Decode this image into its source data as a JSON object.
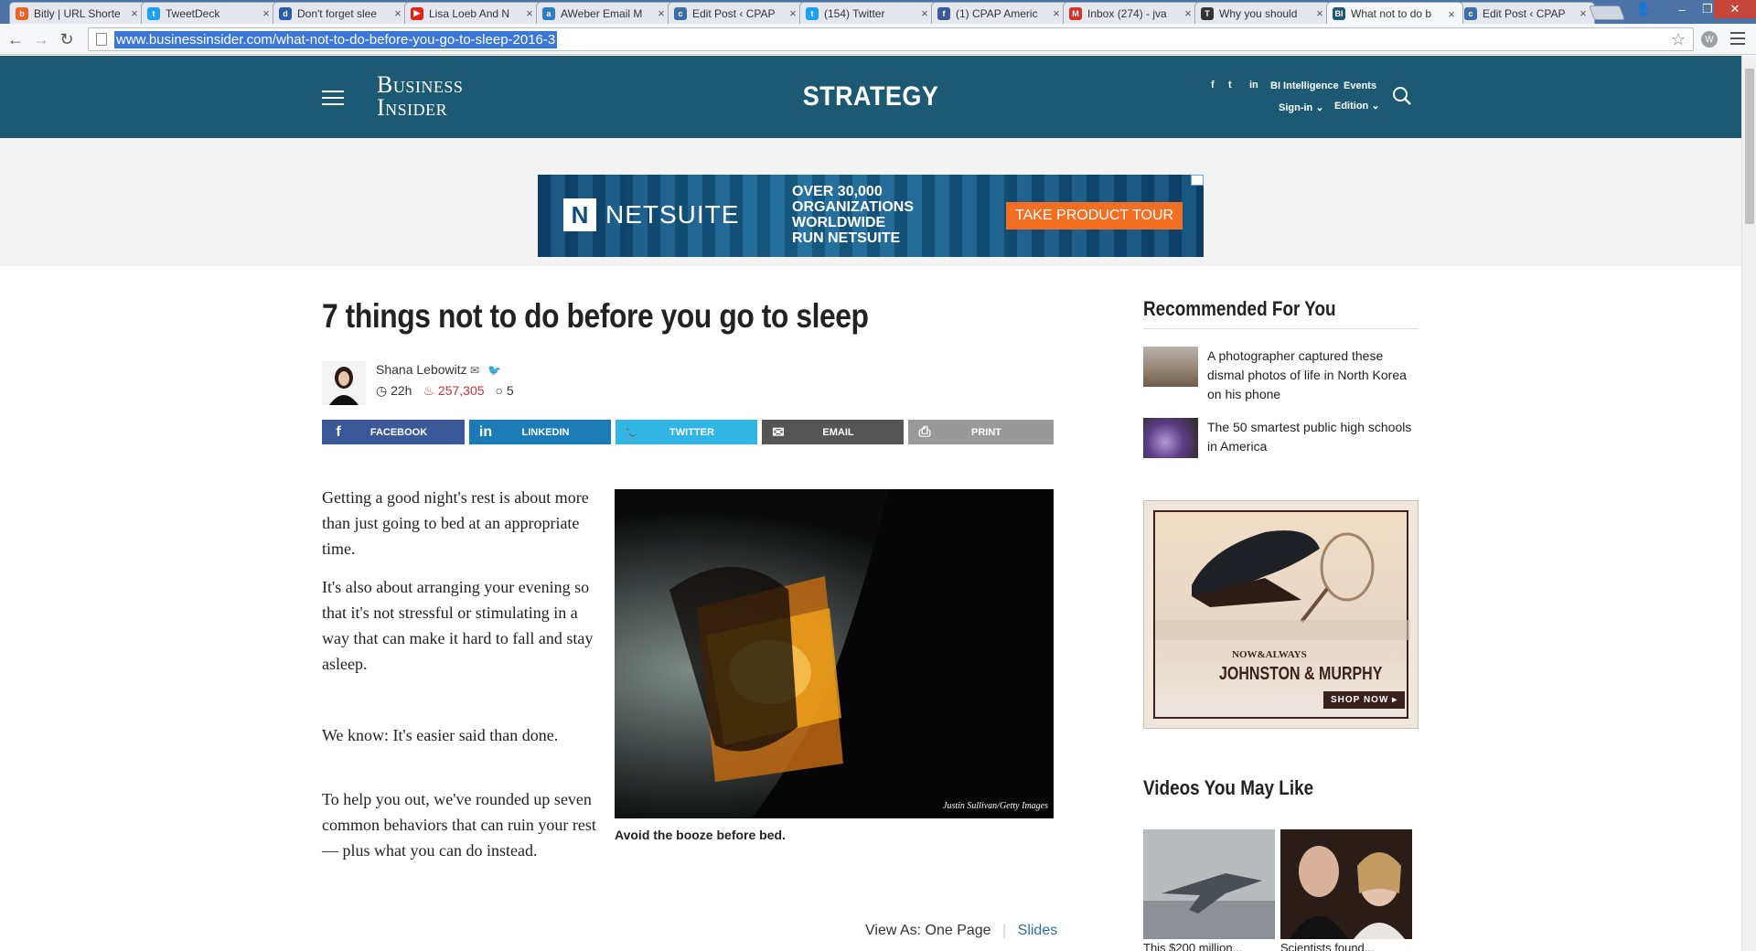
{
  "browser": {
    "tabs": [
      {
        "title": "Bitly | URL Shorte",
        "favicon_color": "#ee6123",
        "favicon_glyph": "b"
      },
      {
        "title": "TweetDeck",
        "favicon_color": "#1da1f2",
        "favicon_glyph": "t"
      },
      {
        "title": "Don't forget slee",
        "favicon_color": "#2a5aa8",
        "favicon_glyph": "d"
      },
      {
        "title": "Lisa Loeb And N",
        "favicon_color": "#e62117",
        "favicon_glyph": "▶"
      },
      {
        "title": "AWeber Email M",
        "favicon_color": "#2d7bc0",
        "favicon_glyph": "a"
      },
      {
        "title": "Edit Post ‹ CPAP",
        "favicon_color": "#3d6ea8",
        "favicon_glyph": "c"
      },
      {
        "title": "(154) Twitter",
        "favicon_color": "#1da1f2",
        "favicon_glyph": "t"
      },
      {
        "title": "(1) CPAP Americ",
        "favicon_color": "#3b5998",
        "favicon_glyph": "f"
      },
      {
        "title": "Inbox (274) - jva",
        "favicon_color": "#d93025",
        "favicon_glyph": "M"
      },
      {
        "title": "Why you should",
        "favicon_color": "#333333",
        "favicon_glyph": "T"
      },
      {
        "title": "What not to do b",
        "favicon_color": "#1b5a72",
        "favicon_glyph": "BI",
        "active": true
      },
      {
        "title": "Edit Post ‹ CPAP",
        "favicon_color": "#3d6ea8",
        "favicon_glyph": "c"
      }
    ],
    "url": "www.businessinsider.com/what-not-to-do-before-you-go-to-sleep-2016-3"
  },
  "header": {
    "logo_line1": "Business",
    "logo_line2": "Insider",
    "section": "STRATEGY",
    "social": [
      "f",
      "t",
      "in"
    ],
    "bi_intelligence": "BI Intelligence",
    "events": "Events",
    "sign_in": "Sign-in",
    "edition": "Edition",
    "bg_color": "#1b5a72"
  },
  "top_ad": {
    "brand": "NETSUITE",
    "headline": "OVER 30,000\nORGANIZATIONS\nWORLDWIDE\nRUN NETSUITE",
    "cta": "TAKE PRODUCT TOUR"
  },
  "article": {
    "title": "7 things not to do before you go to sleep",
    "author": "Shana Lebowitz",
    "time": "22h",
    "views": "257,305",
    "comments": "5",
    "share": [
      {
        "label": "FACEBOOK",
        "color": "#3b5998",
        "icon": "f"
      },
      {
        "label": "LINKEDIN",
        "color": "#1b7bb6",
        "icon": "in"
      },
      {
        "label": "TWITTER",
        "color": "#30b5e5",
        "icon": "🐦"
      },
      {
        "label": "EMAIL",
        "color": "#555555",
        "icon": "✉"
      },
      {
        "label": "PRINT",
        "color": "#999999",
        "icon": "⎙"
      }
    ],
    "paragraphs": [
      "Getting a good night's rest is about more than just going to bed at an appropriate time.",
      "It's also about arranging your evening so that it's not stressful or stimulating in a way that can make it hard to fall and stay asleep.",
      "We know: It's easier said than done.",
      "To help you out, we've rounded up seven common behaviors that can ruin your rest — plus what you can do instead."
    ],
    "photo_credit": "Justin Sullivan/Getty Images",
    "caption": "Avoid the booze before bed.",
    "view_as": "View As: One Page",
    "slides": "Slides"
  },
  "sidebar": {
    "recommended_title": "Recommended For You",
    "recommended": [
      {
        "text": "A photographer captured these dismal photos of life in North Korea on his phone"
      },
      {
        "text": "The 50 smartest public high schools in America"
      }
    ],
    "side_ad": {
      "tagline": "NOW&ALWAYS",
      "brand": "JOHNSTON & MURPHY",
      "cta": "SHOP NOW ▸"
    },
    "videos_title": "Videos You May Like",
    "videos": [
      {
        "caption": "This $200 million..."
      },
      {
        "caption": "Scientists found..."
      }
    ]
  }
}
